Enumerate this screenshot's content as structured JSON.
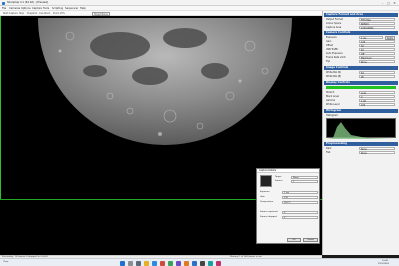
{
  "window": {
    "title": "SharpCap 4.1 (64 bit) - [Preview]",
    "minimize": "–",
    "maximize": "□",
    "close": "✕"
  },
  "menus": [
    "File",
    "Cameras",
    "Options",
    "Capture",
    "Tools",
    "Scripting",
    "Sequencer",
    "Help"
  ],
  "toolbar": {
    "items": [
      "Start Capture",
      "Stop",
      "Snapshot",
      "Live Stack",
      "Zoom 25%"
    ],
    "boxed_label": "Target Name"
  },
  "panel": {
    "sections": {
      "presets": "Capture Format and Area",
      "camera": "Camera Controls",
      "image": "Image Controls",
      "display": "Display Controls",
      "histogram": "Histogram",
      "processing": "Preprocessing"
    },
    "presets": [
      {
        "label": "Output Format",
        "value": "FITS files"
      },
      {
        "label": "Colour Space",
        "value": "RAW16"
      },
      {
        "label": "Capture Area",
        "value": "4144x2822"
      }
    ],
    "camera": [
      {
        "label": "Exposure",
        "value": "2 ms"
      },
      {
        "label": "Gain",
        "value": "120"
      },
      {
        "label": "Offset",
        "value": "30"
      },
      {
        "label": "USB Traffic",
        "value": "40"
      },
      {
        "label": "Auto Exposure",
        "value": "Off"
      },
      {
        "label": "Frame Rate Limit",
        "value": "Maximum"
      },
      {
        "label": "Flip",
        "value": "None"
      }
    ],
    "image": [
      {
        "label": "White Bal (R)",
        "value": "52"
      },
      {
        "label": "White Bal (B)",
        "value": "95"
      }
    ],
    "display": [
      {
        "label": "Stretch",
        "value": "Auto"
      },
      {
        "label": "Black Level",
        "value": "0"
      },
      {
        "label": "Gamma",
        "value": "1.00"
      },
      {
        "label": "White Level",
        "value": "100"
      }
    ],
    "processing": [
      {
        "label": "Dark",
        "value": "None"
      },
      {
        "label": "Flat",
        "value": "None"
      }
    ],
    "histogram_label": "Histogram",
    "apply_label": "Apply",
    "status_bar_color": "#22c422"
  },
  "dialog": {
    "title": "Capture Details",
    "rows": [
      {
        "label": "Target",
        "value": "Moon"
      },
      {
        "label": "Frames",
        "value": "1"
      },
      {
        "label": "Exposure",
        "value": "2 ms"
      },
      {
        "label": "Gain",
        "value": "120"
      },
      {
        "label": "Temperature",
        "value": "18.2 C"
      },
      {
        "label": "Frames captured",
        "value": "0"
      },
      {
        "label": "Frames dropped",
        "value": "0"
      }
    ],
    "ok_label": "OK",
    "cancel_label": "Cancel"
  },
  "status": {
    "left": "Previewing : 14 frames (0 dropped) in 0:00:01",
    "right": "Memory: 1 of 164 frames in use"
  },
  "taskbar": {
    "weather": "Clear",
    "time": "10:42",
    "date": "2/15/2024"
  },
  "colors": {
    "section_header": "#2f5f9e",
    "green_accent": "#2ec02e"
  }
}
